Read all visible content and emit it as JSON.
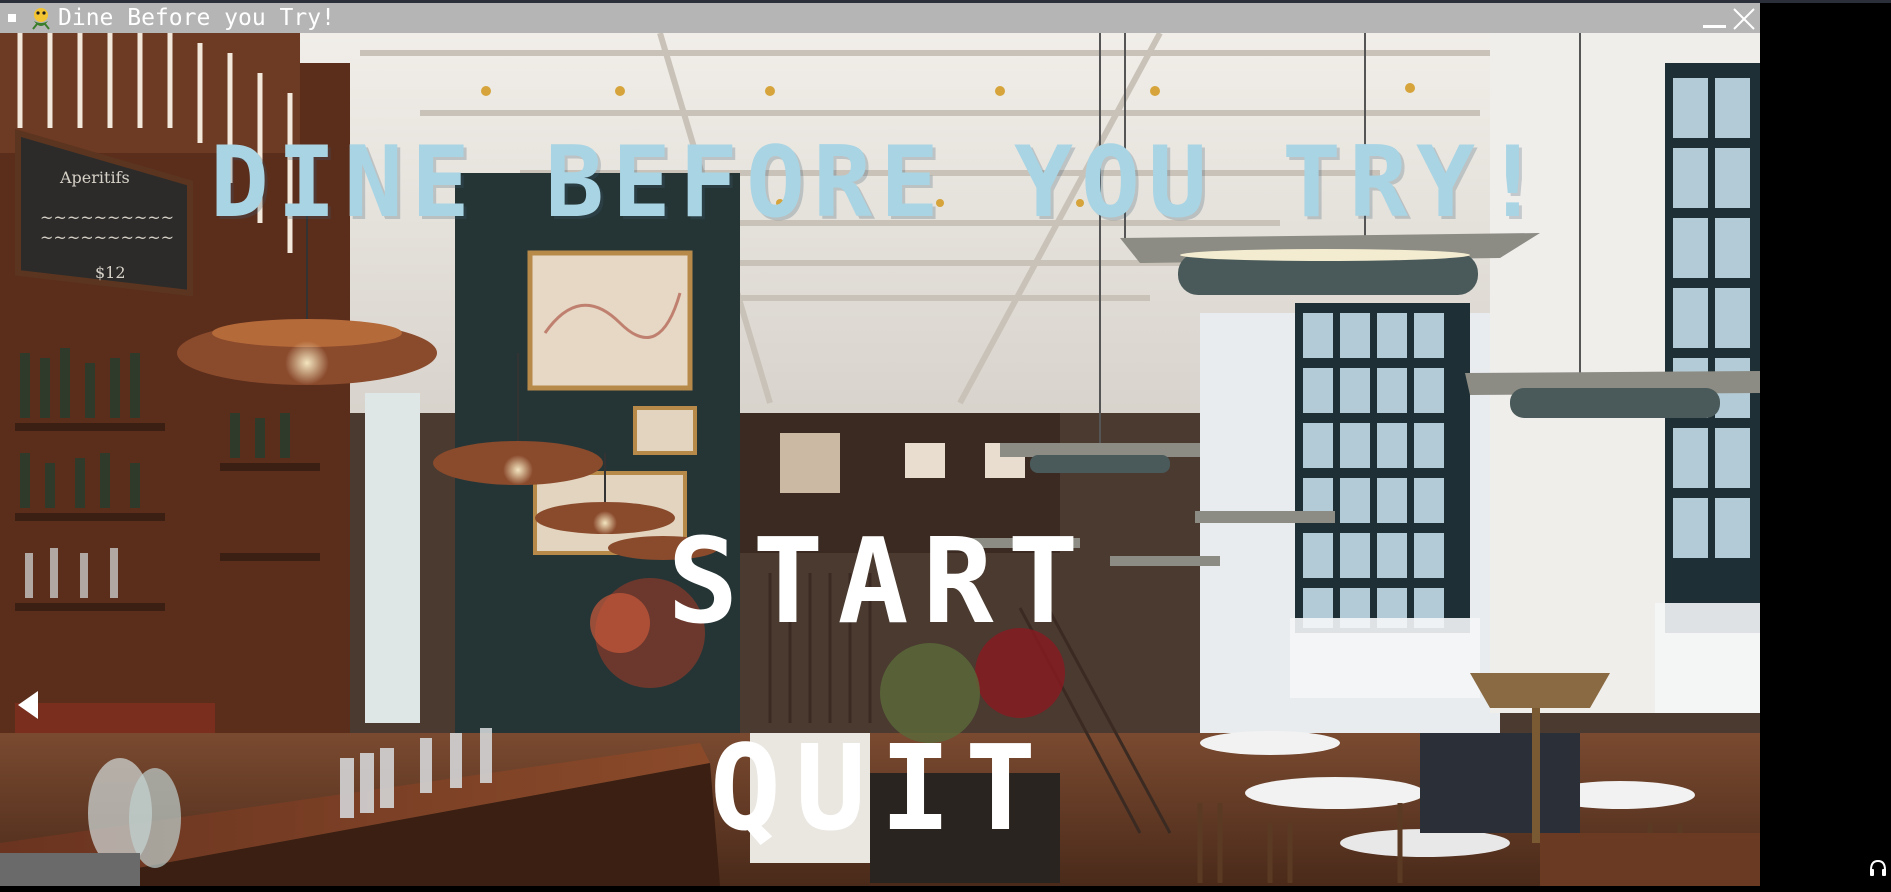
{
  "window": {
    "title": "Dine Before you Try!",
    "icons": {
      "menu": "window-menu-icon",
      "app": "pygame-snake-icon",
      "minimize": "minimize-icon",
      "close": "close-icon"
    }
  },
  "menu": {
    "title": "DINE BEFORE YOU TRY!",
    "options": [
      "START",
      "QUIT"
    ]
  },
  "taskbar": {
    "icons": [
      "headset-icon"
    ]
  },
  "colors": {
    "title_color": "#a8d4e4",
    "option_color": "#ffffff",
    "titlebar_bg": "#b5b5b5"
  }
}
